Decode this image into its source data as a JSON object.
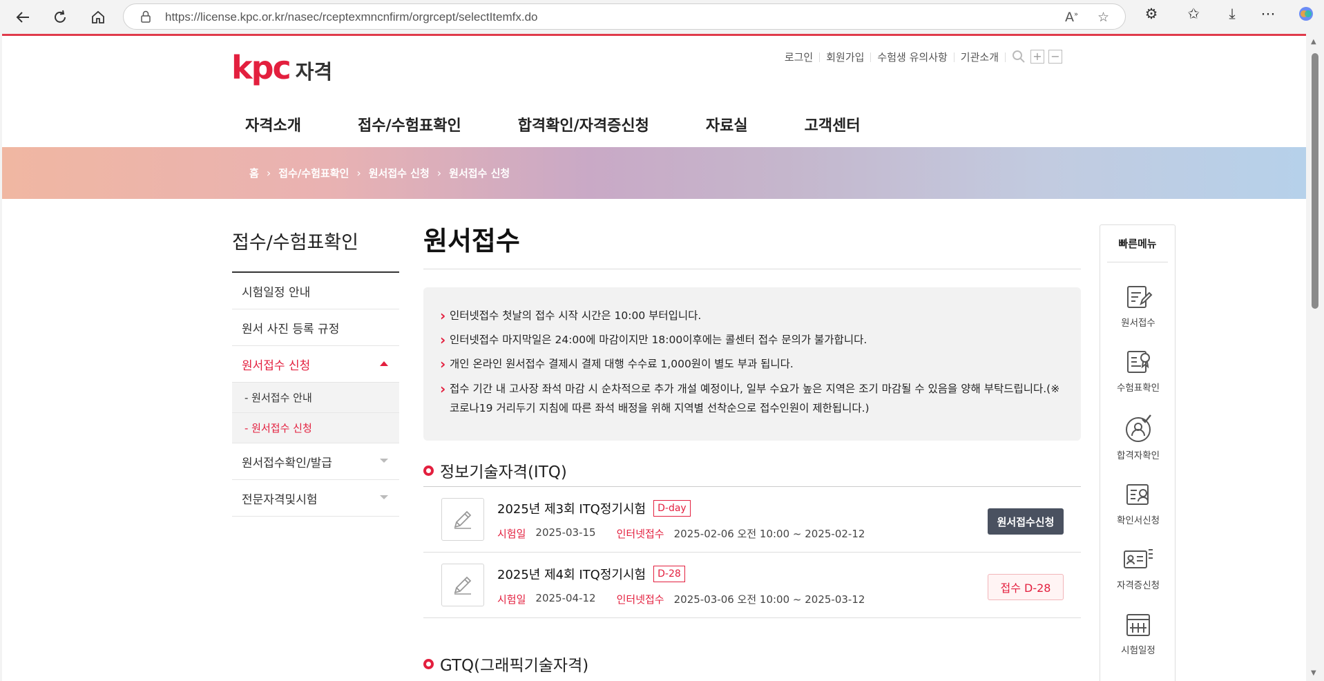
{
  "browser": {
    "url_host": "https://license.kpc.or.kr",
    "url_path": "/nasec/rceptexmncnfirm/orgrcept/selectItemfx.do"
  },
  "header": {
    "logo_text": "kpc",
    "logo_sub": "자격",
    "util_links": [
      "로그인",
      "회원가입",
      "수험생 유의사항",
      "기관소개"
    ],
    "gnb": [
      "자격소개",
      "접수/수험표확인",
      "합격확인/자격증신청",
      "자료실",
      "고객센터"
    ]
  },
  "breadcrumb": [
    "홈",
    "접수/수험표확인",
    "원서접수 신청",
    "원서접수 신청"
  ],
  "sidebar": {
    "title": "접수/수험표확인",
    "items": [
      {
        "label": "시험일정 안내"
      },
      {
        "label": "원서 사진 등록 규정"
      },
      {
        "label": "원서접수 신청"
      },
      {
        "label": "원서접수확인/발급"
      },
      {
        "label": "전문자격및시험"
      }
    ],
    "sub_items": [
      {
        "label": "- 원서접수 안내"
      },
      {
        "label": "- 원서접수 신청"
      }
    ]
  },
  "main": {
    "title": "원서접수",
    "notices": [
      "인터넷접수 첫날의 접수 시작 시간은 10:00 부터입니다.",
      "인터넷접수 마지막일은 24:00에 마감이지만 18:00이후에는 콜센터 접수 문의가 불가합니다.",
      "개인 온라인 원서접수 결제시 결제 대행 수수료 1,000원이 별도 부과 됩니다.",
      "접수 기간 내 고사장 좌석 마감 시 순차적으로 추가 개설 예정이나, 일부 수요가 높은 지역은 조기 마감될 수 있음을 양해 부탁드립니다.(※ 코로나19 거리두기 지침에 따른 좌석 배정을 위해 지역별 선착순으로 접수인원이 제한됩니다.)"
    ],
    "sections": [
      {
        "title": "정보기술자격(ITQ)"
      },
      {
        "title": "GTQ(그래픽기술자격)"
      }
    ],
    "exams": [
      {
        "name": "2025년 제3회 ITQ정기시험",
        "badge": "D-day",
        "exam_date_label": "시험일",
        "exam_date": "2025-03-15",
        "period_label": "인터넷접수",
        "period": "2025-02-06 오전 10:00 ~ 2025-02-12",
        "action": "원서접수신청"
      },
      {
        "name": "2025년 제4회 ITQ정기시험",
        "badge": "D-28",
        "exam_date_label": "시험일",
        "exam_date": "2025-04-12",
        "period_label": "인터넷접수",
        "period": "2025-03-06 오전 10:00 ~ 2025-03-12",
        "action": "접수 D-28"
      }
    ]
  },
  "quick_menu": {
    "title": "빠른메뉴",
    "items": [
      {
        "label": "원서접수",
        "icon": "edit-form-icon"
      },
      {
        "label": "수험표확인",
        "icon": "ticket-icon"
      },
      {
        "label": "합격자확인",
        "icon": "user-check-icon"
      },
      {
        "label": "확인서신청",
        "icon": "certificate-request-icon"
      },
      {
        "label": "자격증신청",
        "icon": "id-card-icon"
      },
      {
        "label": "시험일정",
        "icon": "calendar-icon"
      }
    ]
  },
  "colors": {
    "brand": "#e31f3e",
    "button_dark": "#4a5160"
  }
}
